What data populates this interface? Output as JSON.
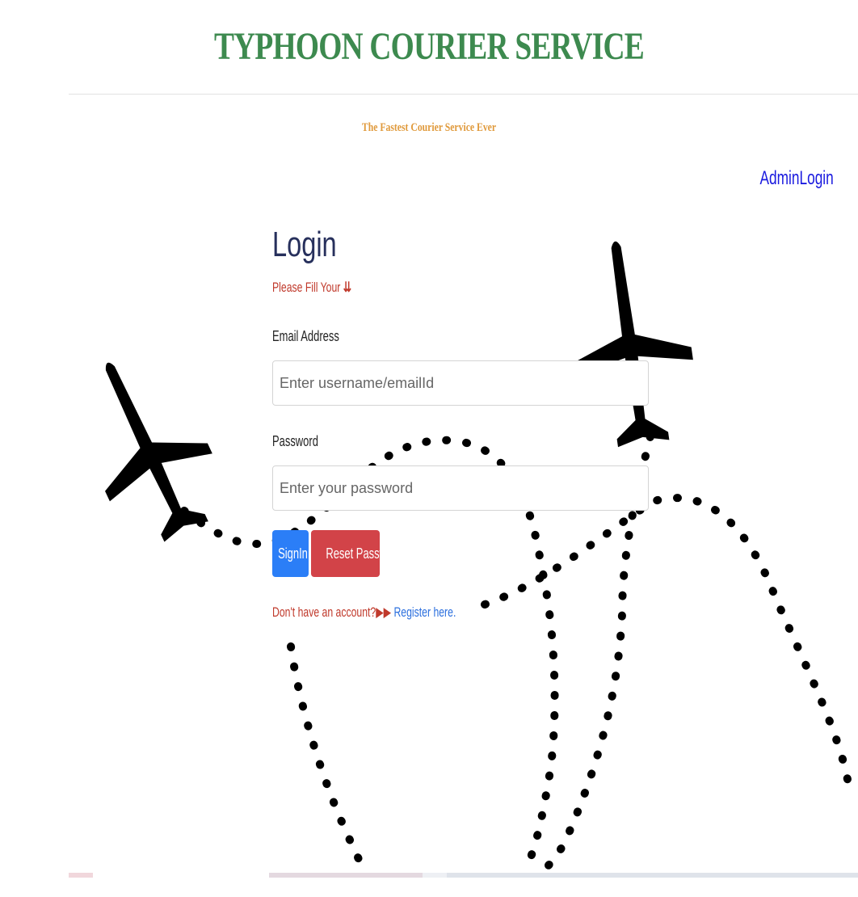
{
  "header": {
    "title": "TYPHOON COURIER SERVICE",
    "tagline": "The Fastest Courier Service Ever",
    "admin_link": "AdminLogin"
  },
  "login": {
    "title": "Login",
    "subtitle": "Please Fill Your",
    "subtitle_icon": "double-down-arrow-icon",
    "email_label": "Email Address",
    "email_placeholder": "Enter username/emailId",
    "password_label": "Password",
    "password_placeholder": "Enter your password",
    "signin_label": "SignIn",
    "reset_label": "Reset Password",
    "no_account_text": "Don't have an account?",
    "register_link": "Register here.",
    "register_icon": "double-right-arrow-icon"
  },
  "colors": {
    "title": "#3d8a4f",
    "tagline": "#e09a3c",
    "admin_link": "#1a1adf",
    "login_heading": "#27305c",
    "subtitle": "#c0392b",
    "signin_button": "#2b7ef7",
    "reset_button": "#d24348",
    "register_link": "#2b6fde"
  }
}
